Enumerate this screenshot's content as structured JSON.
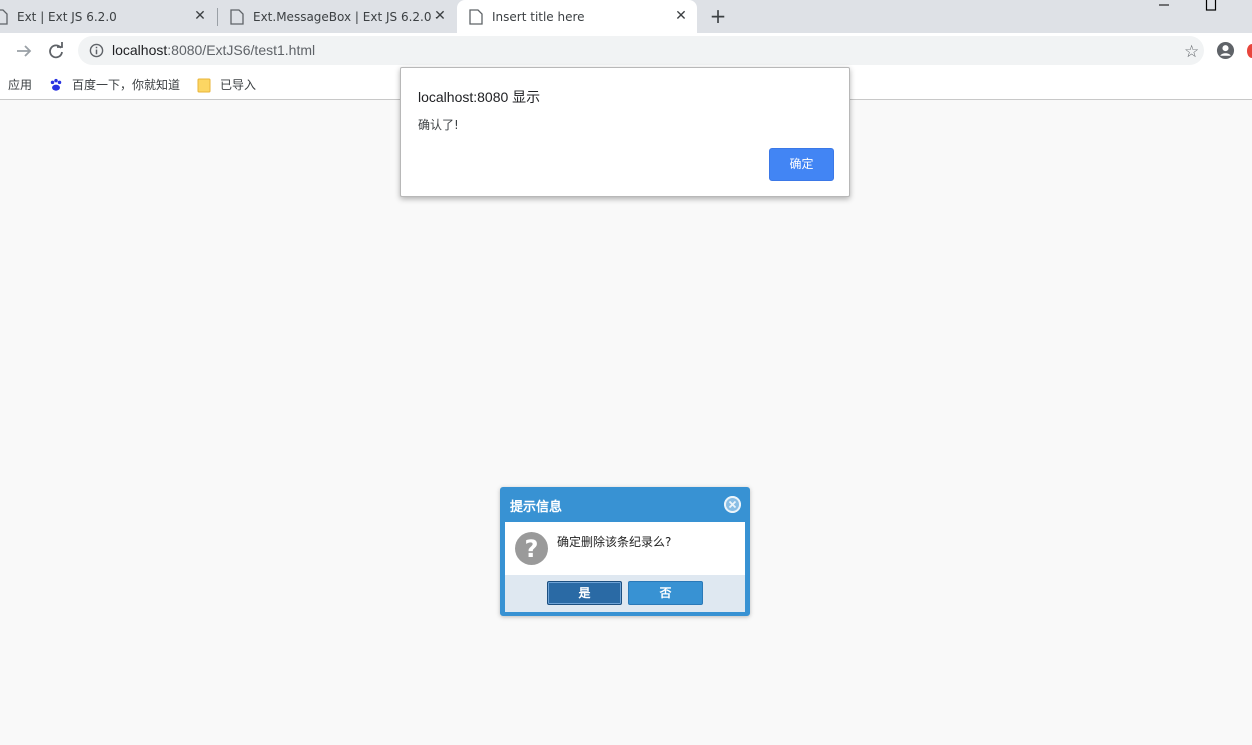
{
  "tabs": [
    {
      "title": "Ext | Ext JS 6.2.0",
      "active": false
    },
    {
      "title": "Ext.MessageBox | Ext JS 6.2.0 -",
      "active": false
    },
    {
      "title": "Insert title here",
      "active": true
    }
  ],
  "toolbar": {
    "url_host": "localhost",
    "url_path": ":8080/ExtJS6/test1.html"
  },
  "bookmarks": [
    {
      "label": "应用",
      "icon": "apps-icon"
    },
    {
      "label": "百度一下，你就知道",
      "icon": "baidu-paw-icon"
    },
    {
      "label": "已导入",
      "icon": "folder-icon"
    }
  ],
  "alert": {
    "title": "localhost:8080 显示",
    "message": "确认了!",
    "ok_label": "确定"
  },
  "msgbox": {
    "title": "提示信息",
    "message": "确定删除该条纪录么?",
    "icon": "question-icon",
    "yes_label": "是",
    "no_label": "否"
  },
  "colors": {
    "tabstrip": "#dee1e6",
    "alert_button": "#4285f4",
    "msgbox_header": "#3892d3",
    "msgbox_footer": "#dfe8f1"
  }
}
